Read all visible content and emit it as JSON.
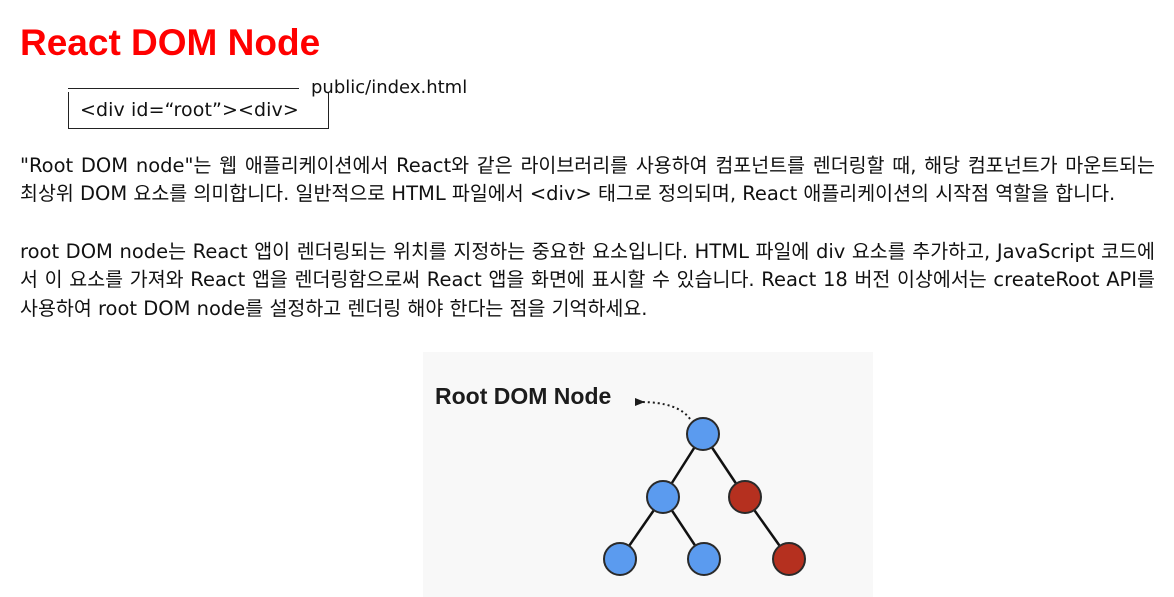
{
  "slide": {
    "title": "React DOM Node",
    "code": {
      "snippet": "<div id=“root”><div>",
      "file_path": "public/index.html"
    },
    "paragraphs": [
      "\"Root DOM node\"는 웹 애플리케이션에서 React와 같은 라이브러리를 사용하여 컴포넌트를 렌더링할 때, 해당 컴포넌트가 마운트되는 최상위 DOM 요소를 의미합니다. 일반적으로 HTML 파일에서 <div> 태그로 정의되며, React 애플리케이션의 시작점 역할을 합니다.",
      "root DOM node는 React 앱이 렌더링되는 위치를 지정하는 중요한 요소입니다. HTML 파일에 div 요소를 추가하고, JavaScript 코드에서 이 요소를 가져와 React 앱을 렌더링함으로써 React 앱을 화면에 표시할 수 있습니다. React 18 버전 이상에서는 createRoot API를 사용하여 root DOM node를 설정하고 렌더링 해야 한다는 점을 기억하세요."
    ],
    "diagram": {
      "label": "Root DOM Node",
      "colors": {
        "blue_node": "#5b9bef",
        "red_node": "#b5301f",
        "node_stroke": "#2a2a2a",
        "edge": "#111111",
        "background": "#f8f8f8"
      }
    }
  }
}
